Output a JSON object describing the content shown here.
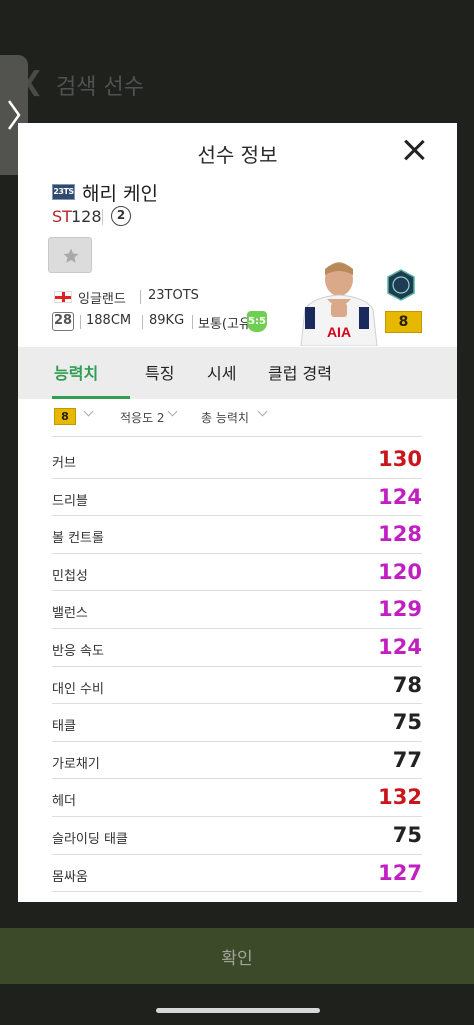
{
  "background": {
    "title": "검색 선수"
  },
  "modal": {
    "title": "선수 정보",
    "player": {
      "season_badge": "23TS",
      "name": "해리 케인",
      "position": "ST",
      "ovr": "128",
      "grade": "2",
      "nation": "잉글랜드",
      "club_season": "23TOTS",
      "age": "28",
      "height": "188CM",
      "weight": "89KG",
      "body_type": "보통(고유)",
      "foot": "5:5",
      "level": "8"
    },
    "tabs": [
      {
        "label": "능력치",
        "active": true
      },
      {
        "label": "특징",
        "active": false
      },
      {
        "label": "시세",
        "active": false
      },
      {
        "label": "클럽 경력",
        "active": false
      }
    ],
    "filters": {
      "level": "8",
      "adaptability": "적응도 2",
      "total": "총 능력치"
    },
    "stats": [
      {
        "name": "커브",
        "value": "130",
        "color": "#c8161c"
      },
      {
        "name": "드리블",
        "value": "124",
        "color": "#c21fc2"
      },
      {
        "name": "볼 컨트롤",
        "value": "128",
        "color": "#c21fc2"
      },
      {
        "name": "민첩성",
        "value": "120",
        "color": "#c21fc2"
      },
      {
        "name": "밸런스",
        "value": "129",
        "color": "#c21fc2"
      },
      {
        "name": "반응 속도",
        "value": "124",
        "color": "#c21fc2"
      },
      {
        "name": "대인 수비",
        "value": "78",
        "color": "#222222"
      },
      {
        "name": "태클",
        "value": "75",
        "color": "#222222"
      },
      {
        "name": "가로채기",
        "value": "77",
        "color": "#222222"
      },
      {
        "name": "헤더",
        "value": "132",
        "color": "#c8161c"
      },
      {
        "name": "슬라이딩 태클",
        "value": "75",
        "color": "#222222"
      },
      {
        "name": "몸싸움",
        "value": "127",
        "color": "#c21fc2"
      }
    ]
  },
  "footer": {
    "confirm_label": "확인"
  }
}
